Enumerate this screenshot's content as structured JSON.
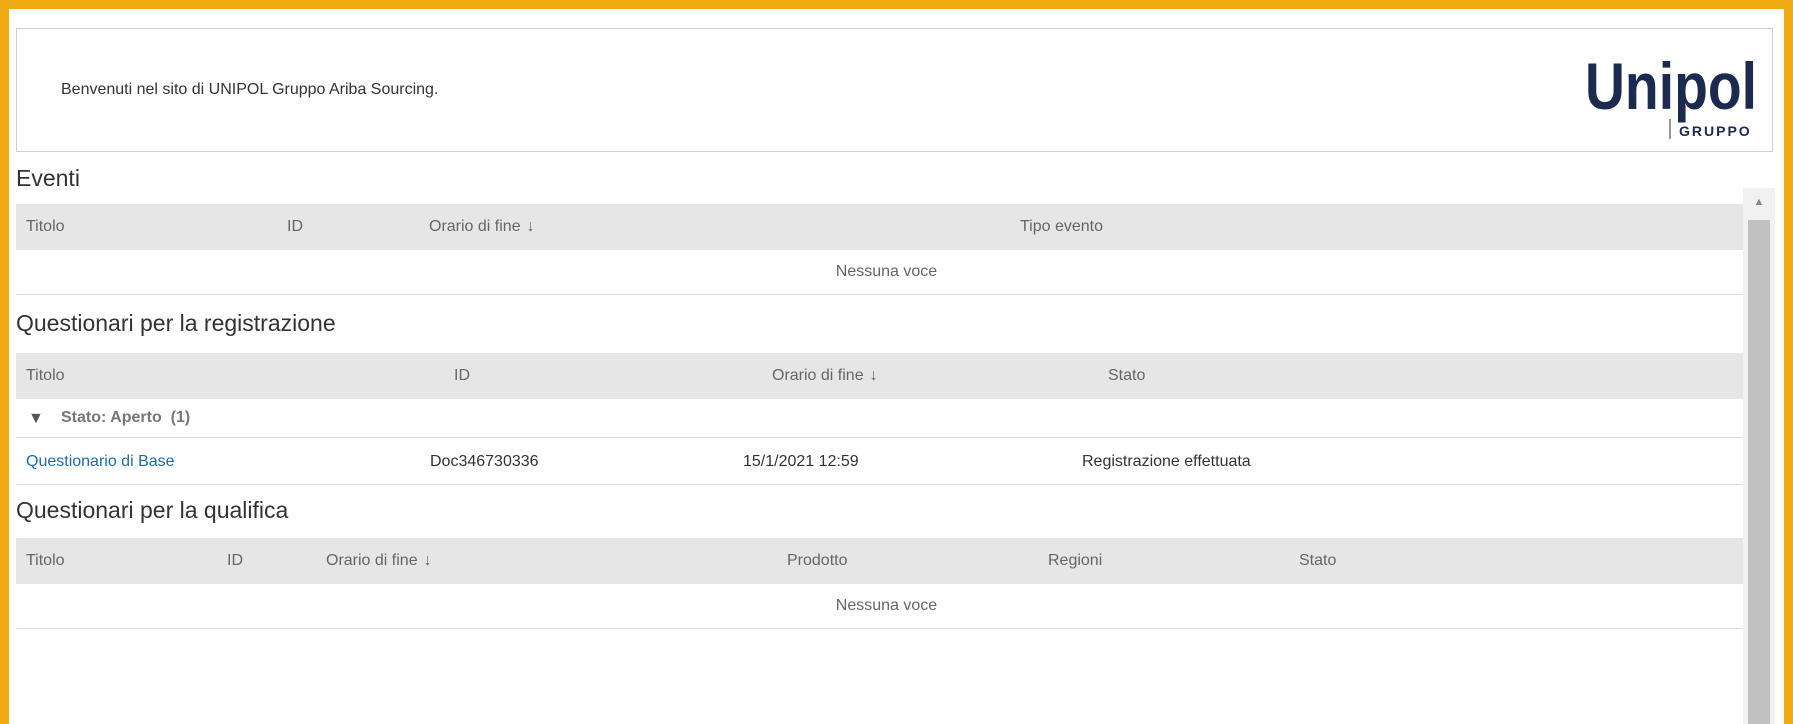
{
  "welcome": {
    "text": "Benvenuti nel sito di UNIPOL Gruppo Ariba Sourcing.",
    "logo_main": "Unipol",
    "logo_sub": "GRUPPO"
  },
  "eventi": {
    "title": "Eventi",
    "columns": [
      "Titolo",
      "ID",
      "Orario di fine",
      "Tipo evento"
    ],
    "empty": "Nessuna voce"
  },
  "registrazione": {
    "title": "Questionari per la registrazione",
    "columns": [
      "Titolo",
      "ID",
      "Orario di fine",
      "Stato"
    ],
    "group": {
      "arrow": "▼",
      "label": "Stato: Aperto",
      "count": "(1)"
    },
    "rows": [
      {
        "titolo": "Questionario di Base",
        "id": "Doc346730336",
        "orario": "15/1/2021 12:59",
        "stato": "Registrazione effettuata"
      }
    ]
  },
  "qualifica": {
    "title": "Questionari per la qualifica",
    "columns": [
      "Titolo",
      "ID",
      "Orario di fine",
      "Prodotto",
      "Regioni",
      "Stato"
    ],
    "empty": "Nessuna voce"
  },
  "sort_icon": "↓",
  "colors": {
    "frame": "#EFAA12",
    "link": "#1E6BA8",
    "header_bg": "#e6e6e6",
    "logo": "#1b2a4e"
  }
}
